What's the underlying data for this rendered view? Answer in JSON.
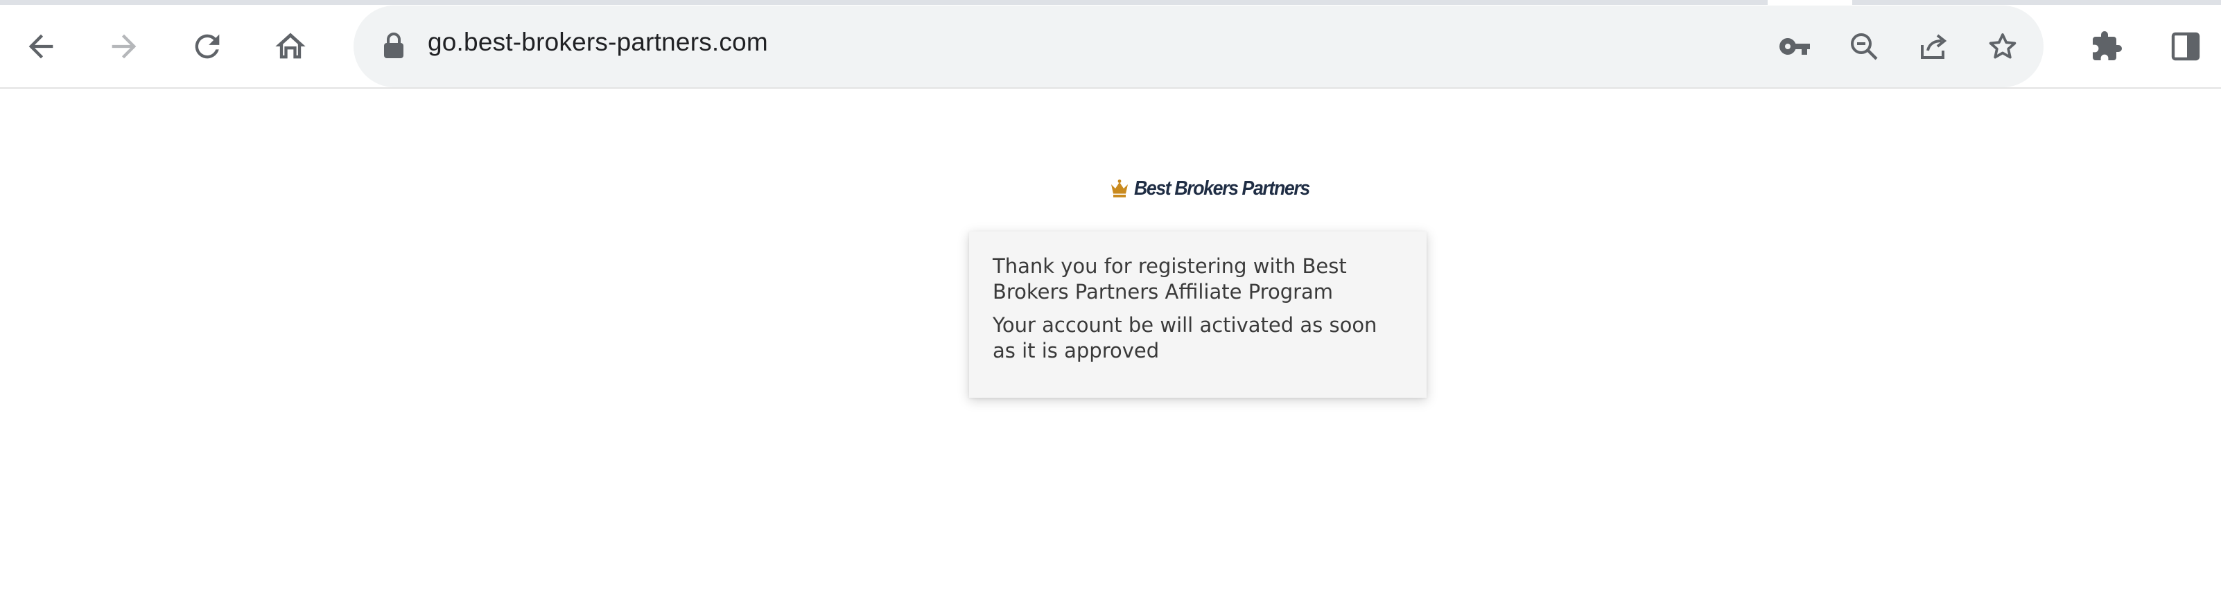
{
  "browser": {
    "url": "go.best-brokers-partners.com",
    "nav": {
      "back_icon": "arrow-left-icon",
      "forward_icon": "arrow-right-icon",
      "reload_icon": "reload-icon",
      "home_icon": "home-icon"
    },
    "omnibox_icons": [
      "lock-icon",
      "key-icon",
      "zoom-out-icon",
      "share-icon",
      "star-icon"
    ],
    "toolbar_icons": [
      "extensions-icon",
      "side-panel-icon"
    ]
  },
  "page": {
    "logo_text": "Best Brokers Partners",
    "message_line1": "Thank you for registering with Best Brokers Partners Affiliate Program",
    "message_line2": "Your account be will activated as soon as it is approved"
  },
  "colors": {
    "logo_crown": "#c98a1e",
    "logo_text": "#1f2d44",
    "omnibox_bg": "#f1f3f4",
    "icon": "#5f6368",
    "icon_disabled": "#b5b7ba"
  }
}
